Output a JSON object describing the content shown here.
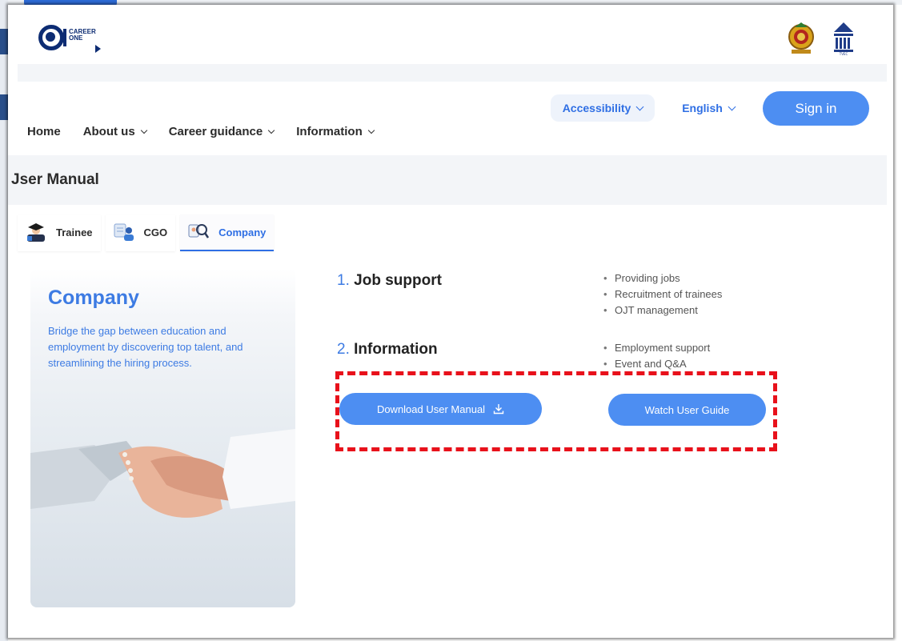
{
  "header": {
    "logo_text_line1": "CAREER",
    "logo_text_line2": "ONE",
    "emblem_icon": "sri-lanka-emblem-icon",
    "tvec_label": "TVEC"
  },
  "nav": {
    "accessibility_label": "Accessibility",
    "language_label": "English",
    "signin_label": "Sign in",
    "menu": [
      {
        "label": "Home",
        "has_dropdown": false
      },
      {
        "label": "About us",
        "has_dropdown": true
      },
      {
        "label": "Career guidance",
        "has_dropdown": true
      },
      {
        "label": "Information",
        "has_dropdown": true
      }
    ]
  },
  "page": {
    "title": "Jser Manual"
  },
  "tabs": [
    {
      "label": "Trainee",
      "icon": "trainee-icon",
      "active": false
    },
    {
      "label": "CGO",
      "icon": "cgo-icon",
      "active": false
    },
    {
      "label": "Company",
      "icon": "company-icon",
      "active": true
    }
  ],
  "card": {
    "title": "Company",
    "description": "Bridge the gap between education and employment by discovering top talent, and streamlining the hiring process."
  },
  "sections": [
    {
      "number": "1.",
      "title": "Job support",
      "bullets": [
        "Providing jobs",
        "Recruitment of trainees",
        "OJT management"
      ]
    },
    {
      "number": "2.",
      "title": "Information",
      "bullets": [
        "Employment support",
        "Event and Q&A"
      ]
    }
  ],
  "actions": {
    "download_label": "Download User Manual",
    "watch_label": "Watch User Guide"
  },
  "colors": {
    "accent": "#4d8ef2",
    "brand_dark": "#0d2c73",
    "highlight": "#e8111b"
  }
}
